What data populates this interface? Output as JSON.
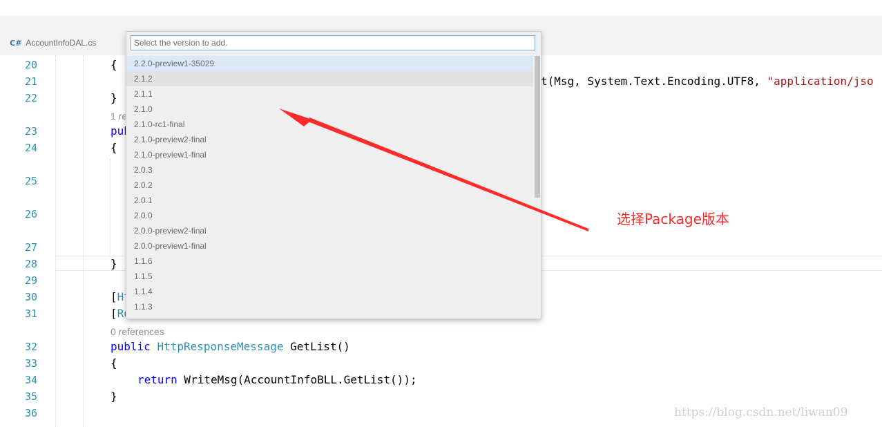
{
  "tab": {
    "icon": "c-sharp-file-icon",
    "label": "AccountInfoDAL.cs"
  },
  "dropdown": {
    "placeholder": "Select the version to add.",
    "versions": [
      "2.2.0-preview1-35029",
      "2.1.2",
      "2.1.1",
      "2.1.0",
      "2.1.0-rc1-final",
      "2.1.0-preview2-final",
      "2.1.0-preview1-final",
      "2.0.3",
      "2.0.2",
      "2.0.1",
      "2.0.0",
      "2.0.0-preview2-final",
      "2.0.0-preview1-final",
      "1.1.6",
      "1.1.5",
      "1.1.4",
      "1.1.3"
    ]
  },
  "editor": {
    "line_numbers": [
      "20",
      "21",
      "22",
      "23",
      "24",
      "25",
      "26",
      "27",
      "28",
      "29",
      "30",
      "31",
      "32",
      "33",
      "34",
      "35",
      "36"
    ],
    "code": {
      "l20_brace": "{",
      "l21_tail_a": "t(Msg, System.Text.Encoding.UTF8, ",
      "l21_tail_str": "\"application/jso",
      "l22_brace": "}",
      "lens_1": "1 re",
      "l23_kw": "pub",
      "l24_brace": "{",
      "l28_brace": "}",
      "l30_a": "[",
      "l30_b": "Ht",
      "l31_a": "[",
      "l31_b": "Ro",
      "lens_0": "0 references",
      "l32_kw": "public",
      "l32_type": "HttpResponseMessage",
      "l32_rest": " GetList()",
      "l33_brace": "{",
      "l34_kw": "return",
      "l34_rest": " WriteMsg(AccountInfoBLL.GetList());",
      "l35_brace": "}"
    }
  },
  "annotation": {
    "text": "选择Package版本",
    "color": "#ff2a2a"
  },
  "watermark": "https://blog.csdn.net/liwan09"
}
